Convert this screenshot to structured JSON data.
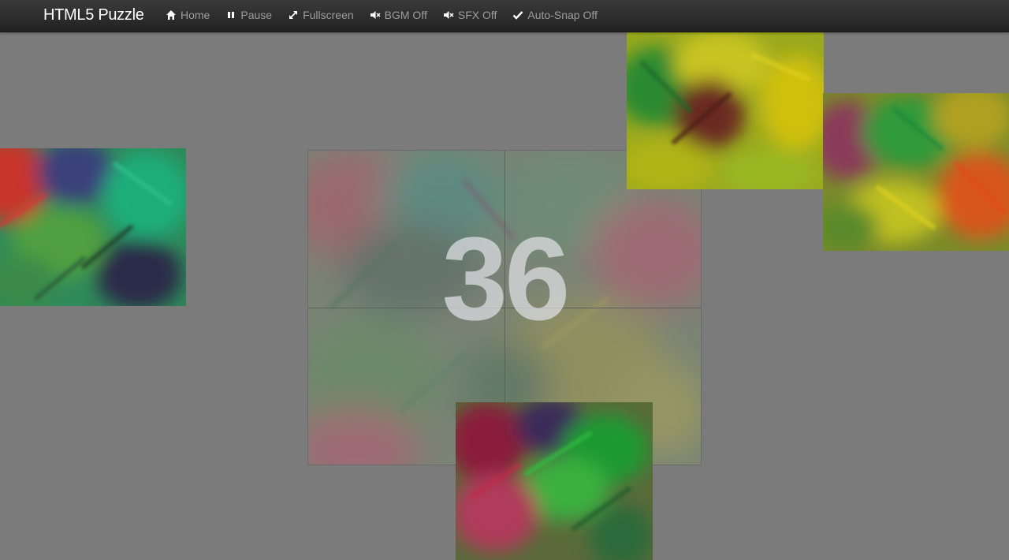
{
  "navbar": {
    "brand": "HTML5 Puzzle",
    "items": [
      {
        "label": "Home",
        "icon": "home-icon"
      },
      {
        "label": "Pause",
        "icon": "pause-icon"
      },
      {
        "label": "Fullscreen",
        "icon": "fullscreen-icon"
      },
      {
        "label": "BGM Off",
        "icon": "volume-off-icon"
      },
      {
        "label": "SFX Off",
        "icon": "volume-off-icon"
      },
      {
        "label": "Auto-Snap Off",
        "icon": "check-icon"
      }
    ]
  },
  "game": {
    "countdown": "36",
    "board_grid": "2x2",
    "colors": {
      "background": "#7b7b7b",
      "navbar": "#2c2c2c",
      "nav_text": "#9d9d9d",
      "brand_text": "#ffffff"
    }
  }
}
